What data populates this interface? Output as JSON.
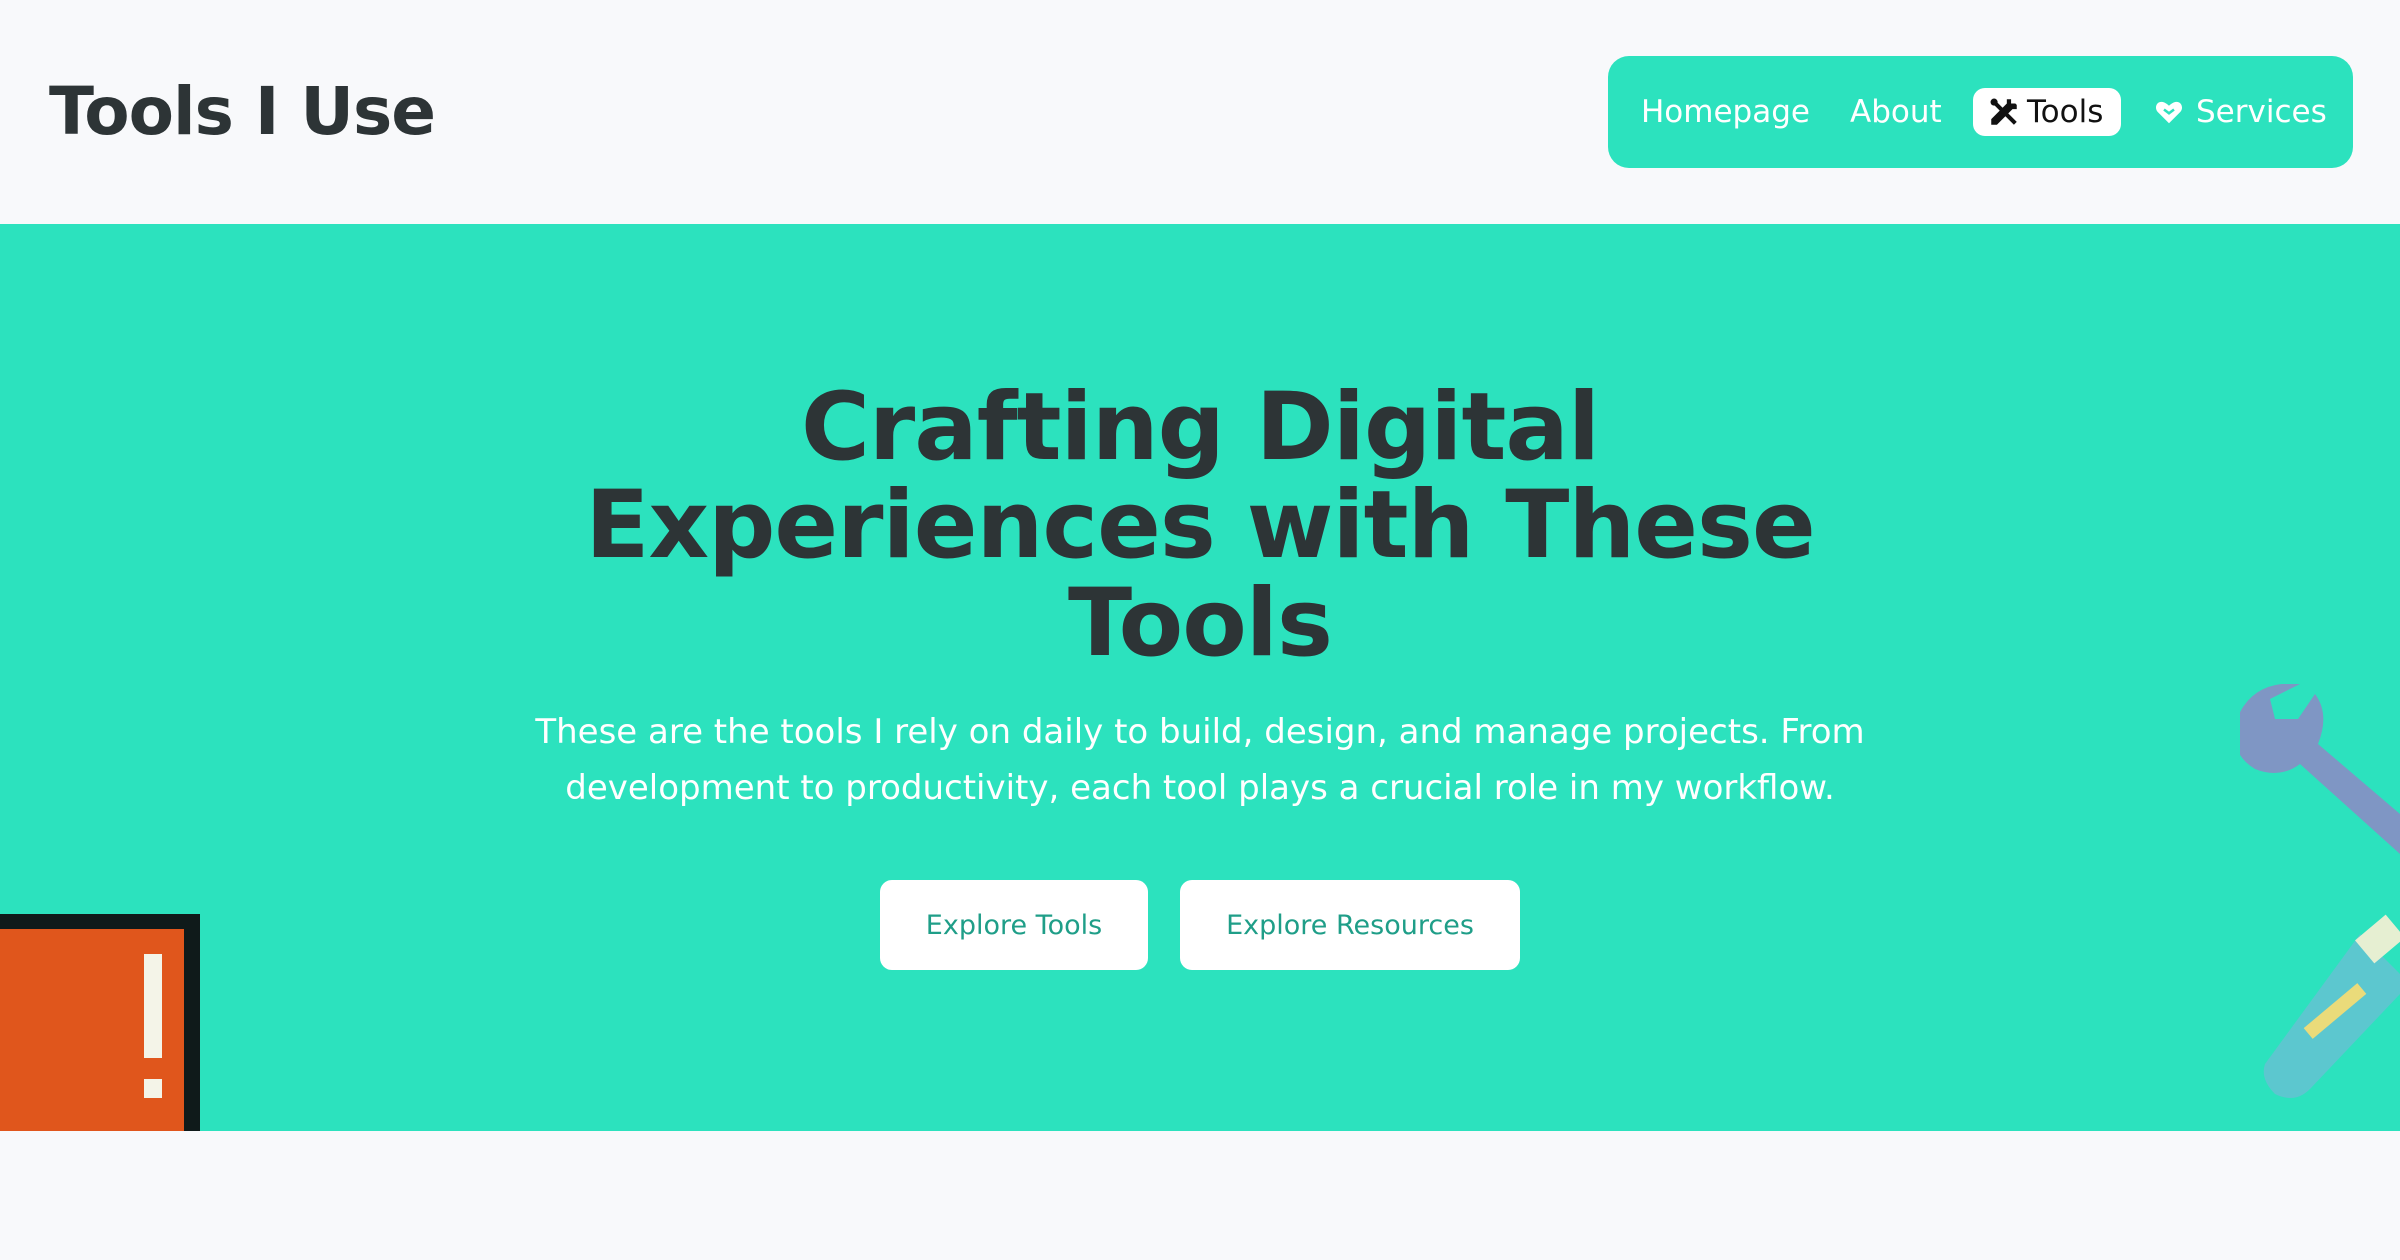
{
  "header": {
    "site_title": "Tools I Use"
  },
  "nav": {
    "items": [
      {
        "label": "Homepage",
        "icon": null
      },
      {
        "label": "About",
        "icon": null
      },
      {
        "label": "Tools",
        "icon": "tools-icon",
        "active": true
      },
      {
        "label": "Services",
        "icon": "heart-handshake-icon"
      }
    ]
  },
  "hero": {
    "title_lines": [
      "Crafting Digital",
      "Experiences with These",
      "Tools"
    ],
    "description": "These are the tools I rely on daily to build, design, and manage projects. From development to productivity, each tool plays a crucial role in my workflow.",
    "buttons": {
      "explore_tools": "Explore Tools",
      "explore_resources": "Explore Resources"
    },
    "decorations": {
      "left": "monitor-warning-illustration",
      "right": "wrench-and-screwdriver-illustration"
    }
  },
  "colors": {
    "accent": "#2ce2be",
    "text_dark": "#2d3436",
    "page_bg": "#f8f9fb",
    "button_text": "#1f9e88"
  }
}
